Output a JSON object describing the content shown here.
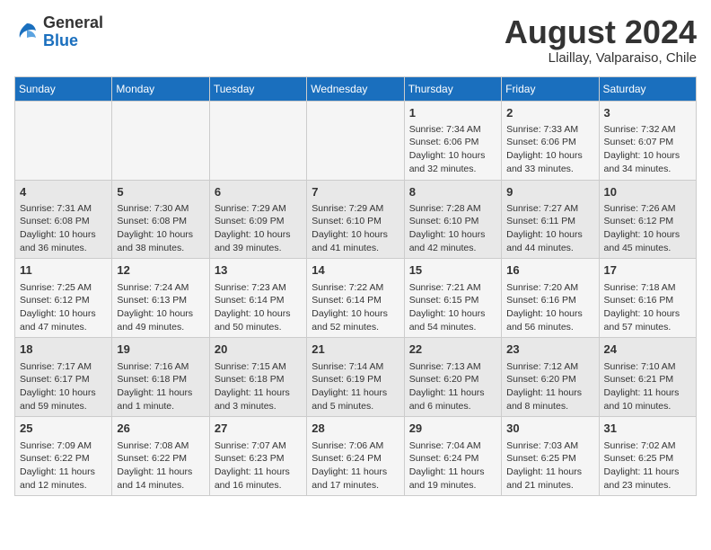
{
  "header": {
    "logo_general": "General",
    "logo_blue": "Blue",
    "month_year": "August 2024",
    "location": "Llaillay, Valparaiso, Chile"
  },
  "days_of_week": [
    "Sunday",
    "Monday",
    "Tuesday",
    "Wednesday",
    "Thursday",
    "Friday",
    "Saturday"
  ],
  "weeks": [
    [
      {
        "day": "",
        "info": ""
      },
      {
        "day": "",
        "info": ""
      },
      {
        "day": "",
        "info": ""
      },
      {
        "day": "",
        "info": ""
      },
      {
        "day": "1",
        "info": "Sunrise: 7:34 AM\nSunset: 6:06 PM\nDaylight: 10 hours\nand 32 minutes."
      },
      {
        "day": "2",
        "info": "Sunrise: 7:33 AM\nSunset: 6:06 PM\nDaylight: 10 hours\nand 33 minutes."
      },
      {
        "day": "3",
        "info": "Sunrise: 7:32 AM\nSunset: 6:07 PM\nDaylight: 10 hours\nand 34 minutes."
      }
    ],
    [
      {
        "day": "4",
        "info": "Sunrise: 7:31 AM\nSunset: 6:08 PM\nDaylight: 10 hours\nand 36 minutes."
      },
      {
        "day": "5",
        "info": "Sunrise: 7:30 AM\nSunset: 6:08 PM\nDaylight: 10 hours\nand 38 minutes."
      },
      {
        "day": "6",
        "info": "Sunrise: 7:29 AM\nSunset: 6:09 PM\nDaylight: 10 hours\nand 39 minutes."
      },
      {
        "day": "7",
        "info": "Sunrise: 7:29 AM\nSunset: 6:10 PM\nDaylight: 10 hours\nand 41 minutes."
      },
      {
        "day": "8",
        "info": "Sunrise: 7:28 AM\nSunset: 6:10 PM\nDaylight: 10 hours\nand 42 minutes."
      },
      {
        "day": "9",
        "info": "Sunrise: 7:27 AM\nSunset: 6:11 PM\nDaylight: 10 hours\nand 44 minutes."
      },
      {
        "day": "10",
        "info": "Sunrise: 7:26 AM\nSunset: 6:12 PM\nDaylight: 10 hours\nand 45 minutes."
      }
    ],
    [
      {
        "day": "11",
        "info": "Sunrise: 7:25 AM\nSunset: 6:12 PM\nDaylight: 10 hours\nand 47 minutes."
      },
      {
        "day": "12",
        "info": "Sunrise: 7:24 AM\nSunset: 6:13 PM\nDaylight: 10 hours\nand 49 minutes."
      },
      {
        "day": "13",
        "info": "Sunrise: 7:23 AM\nSunset: 6:14 PM\nDaylight: 10 hours\nand 50 minutes."
      },
      {
        "day": "14",
        "info": "Sunrise: 7:22 AM\nSunset: 6:14 PM\nDaylight: 10 hours\nand 52 minutes."
      },
      {
        "day": "15",
        "info": "Sunrise: 7:21 AM\nSunset: 6:15 PM\nDaylight: 10 hours\nand 54 minutes."
      },
      {
        "day": "16",
        "info": "Sunrise: 7:20 AM\nSunset: 6:16 PM\nDaylight: 10 hours\nand 56 minutes."
      },
      {
        "day": "17",
        "info": "Sunrise: 7:18 AM\nSunset: 6:16 PM\nDaylight: 10 hours\nand 57 minutes."
      }
    ],
    [
      {
        "day": "18",
        "info": "Sunrise: 7:17 AM\nSunset: 6:17 PM\nDaylight: 10 hours\nand 59 minutes."
      },
      {
        "day": "19",
        "info": "Sunrise: 7:16 AM\nSunset: 6:18 PM\nDaylight: 11 hours\nand 1 minute."
      },
      {
        "day": "20",
        "info": "Sunrise: 7:15 AM\nSunset: 6:18 PM\nDaylight: 11 hours\nand 3 minutes."
      },
      {
        "day": "21",
        "info": "Sunrise: 7:14 AM\nSunset: 6:19 PM\nDaylight: 11 hours\nand 5 minutes."
      },
      {
        "day": "22",
        "info": "Sunrise: 7:13 AM\nSunset: 6:20 PM\nDaylight: 11 hours\nand 6 minutes."
      },
      {
        "day": "23",
        "info": "Sunrise: 7:12 AM\nSunset: 6:20 PM\nDaylight: 11 hours\nand 8 minutes."
      },
      {
        "day": "24",
        "info": "Sunrise: 7:10 AM\nSunset: 6:21 PM\nDaylight: 11 hours\nand 10 minutes."
      }
    ],
    [
      {
        "day": "25",
        "info": "Sunrise: 7:09 AM\nSunset: 6:22 PM\nDaylight: 11 hours\nand 12 minutes."
      },
      {
        "day": "26",
        "info": "Sunrise: 7:08 AM\nSunset: 6:22 PM\nDaylight: 11 hours\nand 14 minutes."
      },
      {
        "day": "27",
        "info": "Sunrise: 7:07 AM\nSunset: 6:23 PM\nDaylight: 11 hours\nand 16 minutes."
      },
      {
        "day": "28",
        "info": "Sunrise: 7:06 AM\nSunset: 6:24 PM\nDaylight: 11 hours\nand 17 minutes."
      },
      {
        "day": "29",
        "info": "Sunrise: 7:04 AM\nSunset: 6:24 PM\nDaylight: 11 hours\nand 19 minutes."
      },
      {
        "day": "30",
        "info": "Sunrise: 7:03 AM\nSunset: 6:25 PM\nDaylight: 11 hours\nand 21 minutes."
      },
      {
        "day": "31",
        "info": "Sunrise: 7:02 AM\nSunset: 6:25 PM\nDaylight: 11 hours\nand 23 minutes."
      }
    ]
  ]
}
